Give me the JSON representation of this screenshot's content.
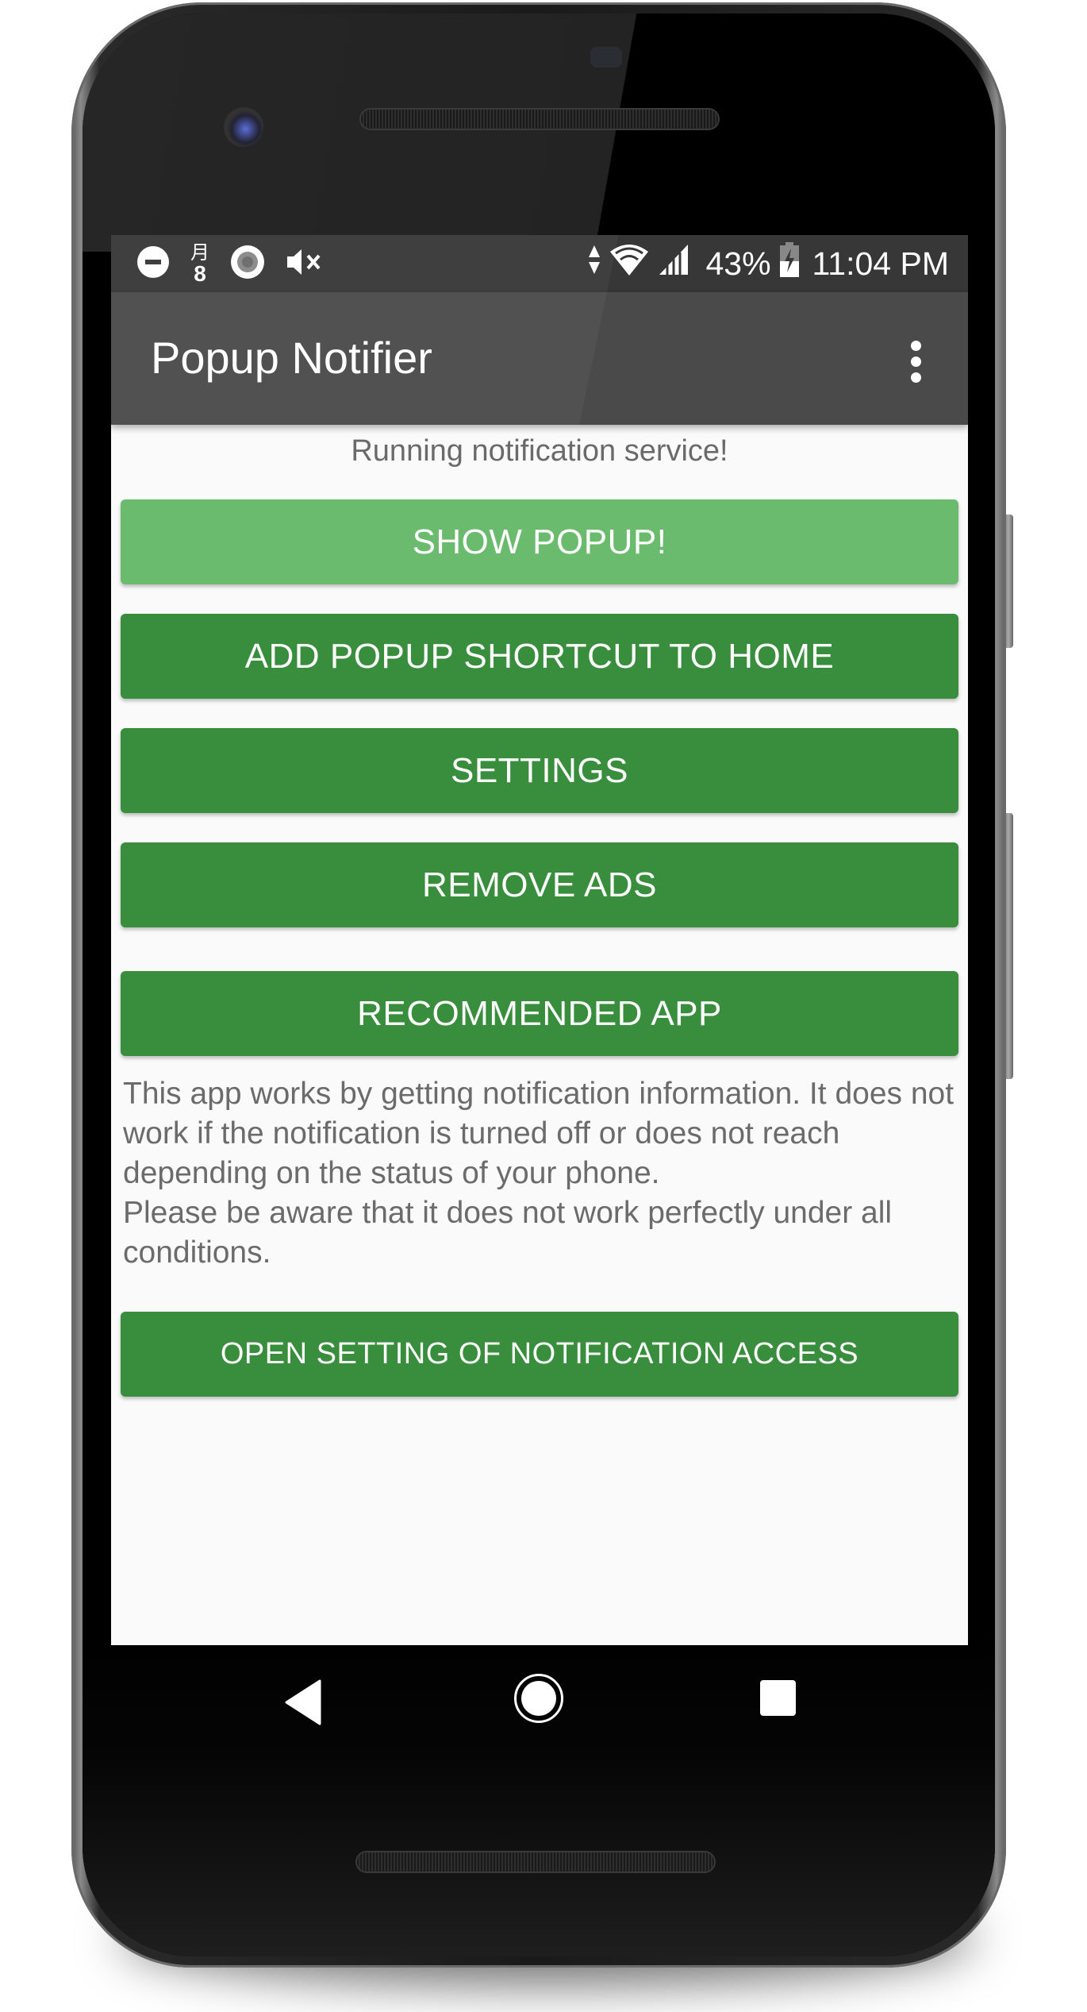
{
  "status_bar": {
    "left_icons": [
      "do-not-disturb-icon",
      "calendar-day-icon",
      "record-icon",
      "mute-icon"
    ],
    "calendar_day": "8",
    "calendar_glyph": "月",
    "right_icons": [
      "data-arrows-icon",
      "wifi-icon",
      "cell-signal-icon",
      "battery-charging-icon"
    ],
    "battery_percent": "43%",
    "time": "11:04 PM"
  },
  "app_bar": {
    "title": "Popup Notifier",
    "menu_icon": "more-vert-icon"
  },
  "main": {
    "status_message": "Running notification service!",
    "buttons": [
      {
        "label": "SHOW POPUP!",
        "color": "#6abb6d"
      },
      {
        "label": "ADD POPUP SHORTCUT TO HOME",
        "color": "#388e3c"
      },
      {
        "label": "SETTINGS",
        "color": "#388e3c"
      },
      {
        "label": "REMOVE ADS",
        "color": "#388e3c"
      },
      {
        "label": "RECOMMENDED APP",
        "color": "#388e3c"
      }
    ],
    "info_text": "This app works by getting notification information. It does not work if the notification is turned off or does not reach depending on the status of your phone.\nPlease be aware that it does not work perfectly under all conditions.",
    "notification_access_button": {
      "label": "OPEN SETTING OF NOTIFICATION ACCESS",
      "color": "#388e3c"
    }
  },
  "nav_bar": {
    "back": "back-icon",
    "home": "home-icon",
    "recents": "recents-icon"
  },
  "colors": {
    "status_bar": "#373737",
    "app_bar": "#4a4a4a",
    "primary_green": "#388e3c",
    "light_green": "#6abb6d",
    "background": "#fafafa",
    "body_text": "#6b6b6b"
  }
}
